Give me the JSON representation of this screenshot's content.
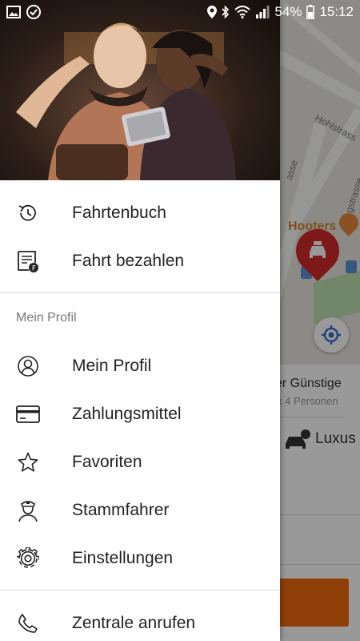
{
  "status_bar": {
    "battery": "54%",
    "time": "15:12"
  },
  "map": {
    "street_1": "Hohlstrass",
    "street_2": "Langstrasse",
    "street_3": "asse",
    "poi": "Hooters"
  },
  "background_sheet": {
    "option_title": "er Günstige",
    "option_subtitle": "x 4 Personen",
    "luxus_label": "Luxus"
  },
  "drawer": {
    "items_top": [
      {
        "label": "Fahrtenbuch",
        "icon": "history-icon"
      },
      {
        "label": "Fahrt bezahlen",
        "icon": "pay-ride-icon"
      }
    ],
    "section_title": "Mein Profil",
    "items_profile": [
      {
        "label": "Mein Profil",
        "icon": "profile-icon"
      },
      {
        "label": "Zahlungsmittel",
        "icon": "credit-card-icon"
      },
      {
        "label": "Favoriten",
        "icon": "star-icon"
      },
      {
        "label": "Stammfahrer",
        "icon": "driver-icon"
      },
      {
        "label": "Einstellungen",
        "icon": "gear-icon"
      }
    ],
    "items_bottom": [
      {
        "label": "Zentrale anrufen",
        "icon": "phone-icon"
      }
    ]
  },
  "colors": {
    "accent": "#f06a10",
    "taxi_pin": "#d32a2a",
    "location_icon": "#3b6fd1"
  }
}
